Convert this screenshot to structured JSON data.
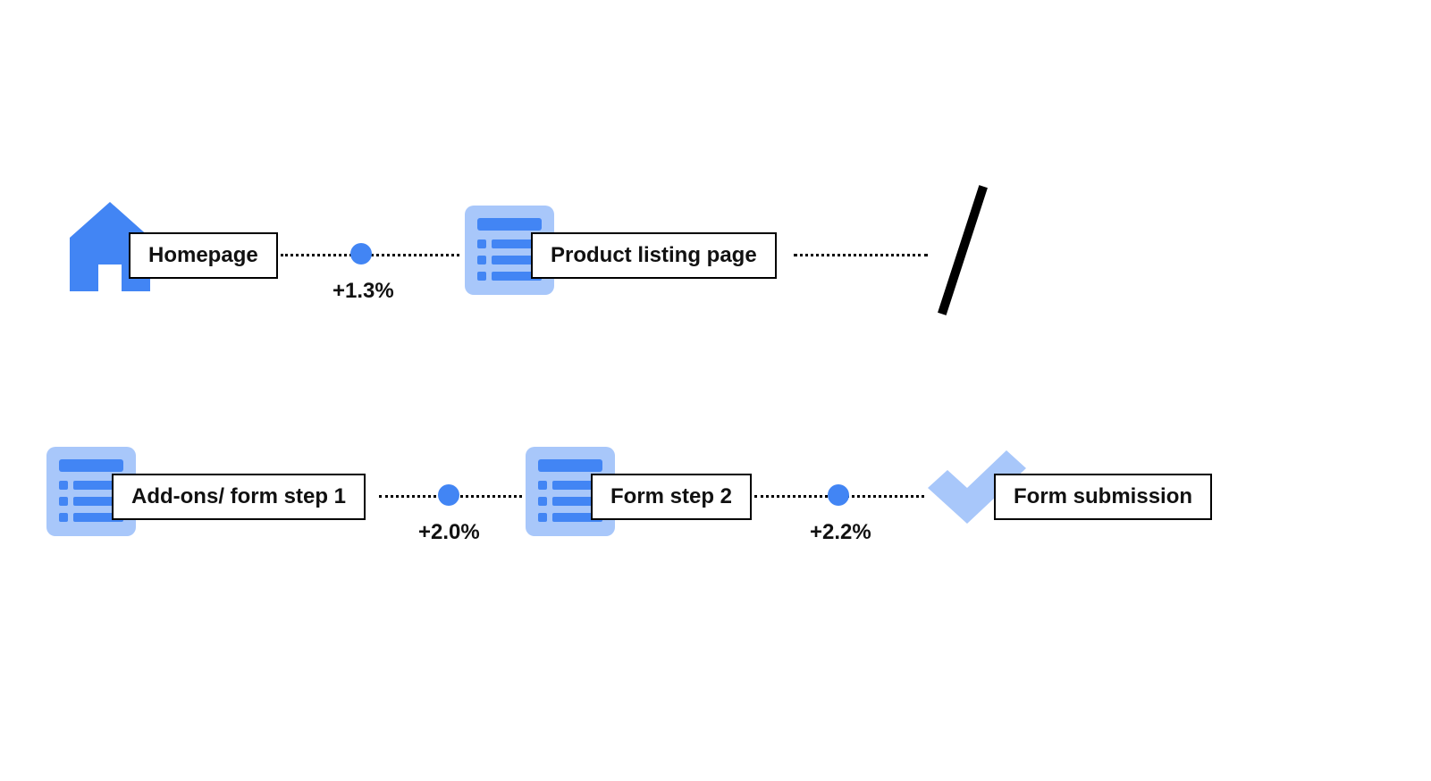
{
  "colors": {
    "accent": "#4285F4",
    "accent_light": "#A8C7FA",
    "text": "#111111"
  },
  "row1": {
    "nodes": [
      {
        "icon": "home",
        "label": "Homepage"
      },
      {
        "icon": "list",
        "label": "Product listing page"
      }
    ],
    "connector1_metric": "+1.3%"
  },
  "row2": {
    "nodes": [
      {
        "icon": "list",
        "label": "Add-ons/ form step 1"
      },
      {
        "icon": "list",
        "label": "Form step 2"
      },
      {
        "icon": "check",
        "label": "Form submission"
      }
    ],
    "connector1_metric": "+2.0%",
    "connector2_metric": "+2.2%"
  }
}
